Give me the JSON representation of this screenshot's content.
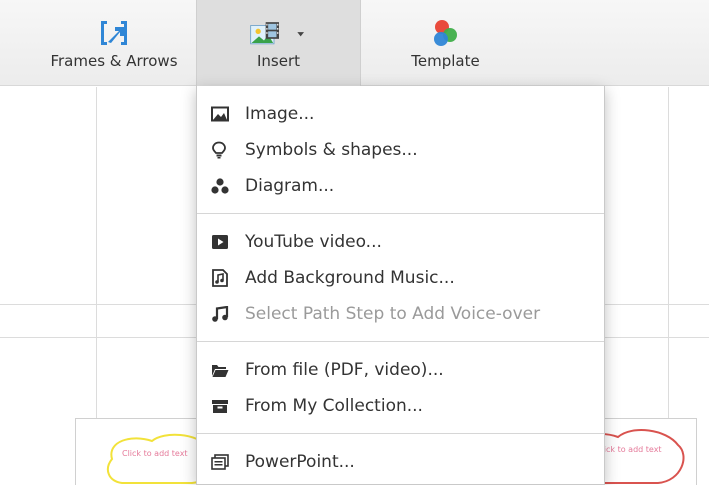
{
  "toolbar": {
    "frames": {
      "label": "Frames & Arrows",
      "icon": "frames-arrows-icon"
    },
    "insert": {
      "label": "Insert",
      "icon": "insert-media-icon"
    },
    "template": {
      "label": "Template",
      "icon": "template-icon"
    }
  },
  "menu": {
    "items": [
      {
        "label": "Image...",
        "icon": "image-icon",
        "enabled": true
      },
      {
        "label": "Symbols & shapes...",
        "icon": "lightbulb-icon",
        "enabled": true
      },
      {
        "label": "Diagram...",
        "icon": "diagram-icon",
        "enabled": true
      },
      {
        "label": "YouTube video...",
        "icon": "youtube-icon",
        "enabled": true
      },
      {
        "label": "Add Background Music...",
        "icon": "music-file-icon",
        "enabled": true
      },
      {
        "label": "Select Path Step to Add Voice-over",
        "icon": "music-note-icon",
        "enabled": false
      },
      {
        "label": "From file (PDF, video)...",
        "icon": "folder-icon",
        "enabled": true
      },
      {
        "label": "From My Collection...",
        "icon": "collection-icon",
        "enabled": true
      },
      {
        "label": "PowerPoint...",
        "icon": "powerpoint-icon",
        "enabled": true
      }
    ]
  },
  "canvas": {
    "left_bubble_text": "Click to add text",
    "right_bubble_text": "Click to add text"
  },
  "colors": {
    "accent_blue": "#2f86d6",
    "left_bubble_outline": "#f2e23a",
    "right_bubble_outline": "#d9534f",
    "bubble_text": "#e57a9a"
  }
}
